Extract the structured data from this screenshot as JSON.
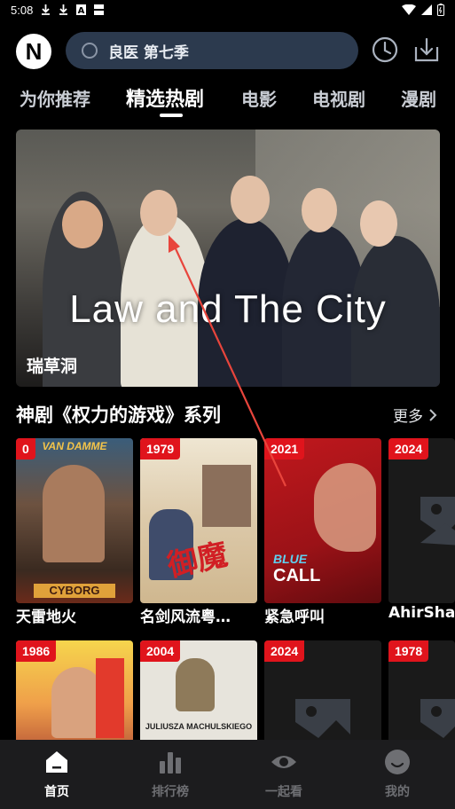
{
  "status_bar": {
    "time": "5:08",
    "icons": [
      "download-icon",
      "download-icon",
      "font-icon",
      "sim-icon"
    ],
    "right_icons": [
      "wifi-icon",
      "signal-icon",
      "battery-icon"
    ]
  },
  "header": {
    "logo_letter": "N",
    "search_text": "良医 第七季",
    "icons": [
      "history-icon",
      "download-icon"
    ]
  },
  "tabs": [
    {
      "label": "为你推荐",
      "active": false
    },
    {
      "label": "精选热剧",
      "active": true
    },
    {
      "label": "电影",
      "active": false
    },
    {
      "label": "电视剧",
      "active": false
    },
    {
      "label": "漫剧",
      "active": false
    }
  ],
  "banner": {
    "title": "Law and The City",
    "caption": "瑞草洞"
  },
  "section": {
    "title": "神剧《权力的游戏》系列",
    "more_label": "更多"
  },
  "row1": [
    {
      "badge": "0",
      "title": "天雷地火",
      "poster_text": "VAN DAMME / CYBORG",
      "has_poster": true
    },
    {
      "badge": "1979",
      "title": "名剑风流粤…",
      "poster_text": "御魔",
      "has_poster": true
    },
    {
      "badge": "2021",
      "title": "紧急呼叫",
      "poster_text": "BLUE CALL",
      "has_poster": true
    },
    {
      "badge": "2024",
      "title": "AhirSha",
      "has_poster": false
    }
  ],
  "row2": [
    {
      "badge": "1986",
      "has_poster": true
    },
    {
      "badge": "2004",
      "poster_text": "JULIUSZA MACHULSKIEGO",
      "has_poster": true
    },
    {
      "badge": "2024",
      "has_poster": false
    },
    {
      "badge": "1978",
      "has_poster": false
    }
  ],
  "bottom_nav": [
    {
      "label": "首页",
      "icon": "home-icon",
      "active": true
    },
    {
      "label": "排行榜",
      "icon": "chart-icon",
      "active": false
    },
    {
      "label": "一起看",
      "icon": "eye-icon",
      "active": false
    },
    {
      "label": "我的",
      "icon": "profile-icon",
      "active": false
    }
  ],
  "colors": {
    "badge": "#e0141c",
    "search_bg": "#2c3a4e",
    "nav_bg": "#1c1c1e",
    "annotation_arrow": "#e8453c"
  }
}
